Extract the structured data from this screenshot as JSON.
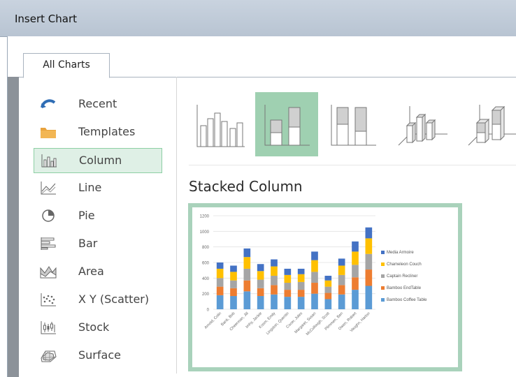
{
  "window": {
    "title": "Insert Chart"
  },
  "tabs": [
    {
      "label": "All Charts"
    }
  ],
  "sidebar": {
    "items": [
      {
        "label": "Recent",
        "icon": "recent-icon"
      },
      {
        "label": "Templates",
        "icon": "folder-icon"
      },
      {
        "label": "Column",
        "icon": "column-chart-icon",
        "selected": true
      },
      {
        "label": "Line",
        "icon": "line-chart-icon"
      },
      {
        "label": "Pie",
        "icon": "pie-chart-icon"
      },
      {
        "label": "Bar",
        "icon": "bar-chart-icon"
      },
      {
        "label": "Area",
        "icon": "area-chart-icon"
      },
      {
        "label": "X Y (Scatter)",
        "icon": "scatter-chart-icon"
      },
      {
        "label": "Stock",
        "icon": "stock-chart-icon"
      },
      {
        "label": "Surface",
        "icon": "surface-chart-icon"
      }
    ]
  },
  "subtypes": [
    {
      "icon": "clustered-column-icon"
    },
    {
      "icon": "stacked-column-icon",
      "selected": true
    },
    {
      "icon": "100-stacked-column-icon"
    },
    {
      "icon": "3d-clustered-column-icon"
    },
    {
      "icon": "3d-stacked-column-icon"
    }
  ],
  "preview_title": "Stacked Column",
  "chart_data": {
    "type": "bar",
    "stacked": true,
    "ylim": [
      0,
      1200
    ],
    "yticks": [
      "1200",
      "1000",
      "800",
      "600",
      "400",
      "200",
      "0"
    ],
    "categories": [
      "Arnold, Colin",
      "Bank, Bob",
      "Cheerman, Jill",
      "Imhy, Jackie",
      "Kosm, Emily",
      "Lingston, Quentin",
      "Cocer, Jules",
      "Margaret, Susan",
      "McCullough, Scott",
      "Plimmen, Ben",
      "Owen, Robert",
      "Vaughn, Harlon"
    ],
    "series": [
      {
        "name": "Bamboo Coffee Table",
        "color": "#5b9bd5",
        "values": [
          180,
          170,
          230,
          170,
          190,
          160,
          160,
          200,
          130,
          190,
          250,
          300
        ]
      },
      {
        "name": "Bamboo EndTable",
        "color": "#ed7d31",
        "values": [
          110,
          100,
          140,
          100,
          120,
          90,
          90,
          140,
          80,
          120,
          160,
          210
        ]
      },
      {
        "name": "Captain Recliner",
        "color": "#a5a5a5",
        "values": [
          110,
          100,
          150,
          110,
          120,
          90,
          100,
          140,
          80,
          130,
          160,
          200
        ]
      },
      {
        "name": "Chameleon Couch",
        "color": "#ffc000",
        "values": [
          120,
          110,
          150,
          110,
          120,
          100,
          100,
          150,
          80,
          120,
          170,
          200
        ]
      },
      {
        "name": "Media Armoire",
        "color": "#4472c4",
        "values": [
          80,
          80,
          110,
          90,
          90,
          80,
          70,
          110,
          60,
          90,
          130,
          140
        ]
      }
    ],
    "legend": "right"
  }
}
